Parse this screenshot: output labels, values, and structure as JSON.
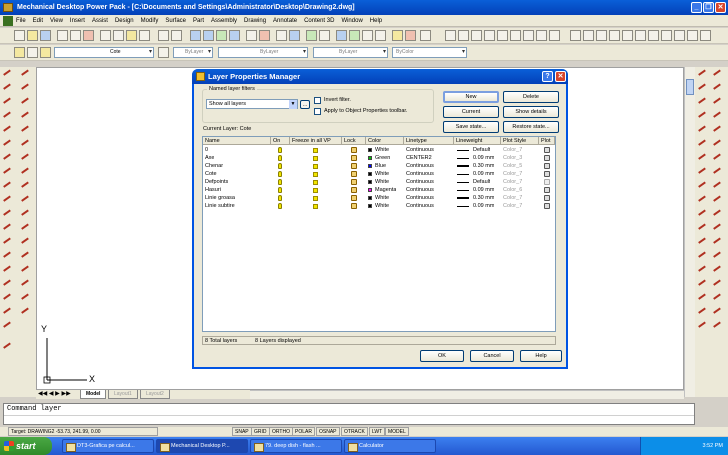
{
  "window": {
    "title": "Mechanical Desktop Power Pack - [C:\\Documents and Settings\\Administrator\\Desktop\\Drawing2.dwg]",
    "minimize": "_",
    "restore": "❐",
    "close": "✕"
  },
  "menu": [
    "File",
    "Edit",
    "View",
    "Insert",
    "Assist",
    "Design",
    "Modify",
    "Surface",
    "Part",
    "Assembly",
    "Drawing",
    "Annotate",
    "Content 3D",
    "Window",
    "Help"
  ],
  "layer_toolbar": {
    "current_layer": "Cote",
    "color": "ByLayer",
    "linetype": "ByLayer",
    "lineweight": "ByLayer",
    "plotstyle": "ByColor"
  },
  "ucs": {
    "y_label": "Y",
    "x_label": "X"
  },
  "tabs": [
    "Model",
    "Layout1",
    "Layout2"
  ],
  "command": {
    "line1": "Command layer",
    "line2": ""
  },
  "status": {
    "target": "Target: DRAWING2  -53.73, 241.99, 0.00",
    "toggles": [
      "SNAP",
      "GRID",
      "ORTHO",
      "POLAR",
      "OSNAP",
      "OTRACK",
      "LWT",
      "MODEL"
    ]
  },
  "taskbar": {
    "start": "start",
    "tasks": [
      "DT3-Grafica pe calcul...",
      "Mechanical Desktop P...",
      "79. deep dish - flash ...",
      "Calculator"
    ],
    "clock": "3:52 PM"
  },
  "dialog": {
    "title": "Layer Properties Manager",
    "help": "?",
    "close": "✕",
    "named_filters_label": "Named layer filters",
    "filter_value": "Show all layers",
    "filter_browse": "...",
    "invert_filter": "Invert filter.",
    "apply_toolbar": "Apply to Object Properties toolbar.",
    "current_layer_label": "Current Layer:  Cote",
    "buttons": {
      "new": "New",
      "delete": "Delete",
      "current": "Current",
      "show_details": "Show details",
      "save_state": "Save state...",
      "restore_state": "Restore state...",
      "ok": "OK",
      "cancel": "Cancel",
      "help": "Help"
    },
    "columns": [
      "Name",
      "On",
      "Freeze in all VP",
      "Lock",
      "Color",
      "Linetype",
      "Lineweight",
      "Plot Style",
      "Plot"
    ],
    "layers": [
      {
        "name": "0",
        "color_name": "White",
        "color_hex": "#000000",
        "linetype": "Continuous",
        "lineweight": "Default",
        "plotstyle": "Color_7"
      },
      {
        "name": "Axe",
        "color_name": "Green",
        "color_hex": "#00c000",
        "linetype": "CENTER2",
        "lineweight": "0.09 mm",
        "plotstyle": "Color_3"
      },
      {
        "name": "Chenar",
        "color_name": "Blue",
        "color_hex": "#0000ff",
        "linetype": "Continuous",
        "lineweight": "0.30 mm",
        "plotstyle": "Color_5"
      },
      {
        "name": "Cote",
        "color_name": "White",
        "color_hex": "#000000",
        "linetype": "Continuous",
        "lineweight": "0.09 mm",
        "plotstyle": "Color_7"
      },
      {
        "name": "Defpoints",
        "color_name": "White",
        "color_hex": "#000000",
        "linetype": "Continuous",
        "lineweight": "Default",
        "plotstyle": "Color_7"
      },
      {
        "name": "Hasuri",
        "color_name": "Magenta",
        "color_hex": "#ff00ff",
        "linetype": "Continuous",
        "lineweight": "0.09 mm",
        "plotstyle": "Color_6"
      },
      {
        "name": "Linie groasa",
        "color_name": "White",
        "color_hex": "#000000",
        "linetype": "Continuous",
        "lineweight": "0.30 mm",
        "plotstyle": "Color_7"
      },
      {
        "name": "Linie subtire",
        "color_name": "White",
        "color_hex": "#000000",
        "linetype": "Continuous",
        "lineweight": "0.09 mm",
        "plotstyle": "Color_7"
      }
    ],
    "status_total": "8 Total layers",
    "status_displayed": "8 Layers displayed"
  }
}
